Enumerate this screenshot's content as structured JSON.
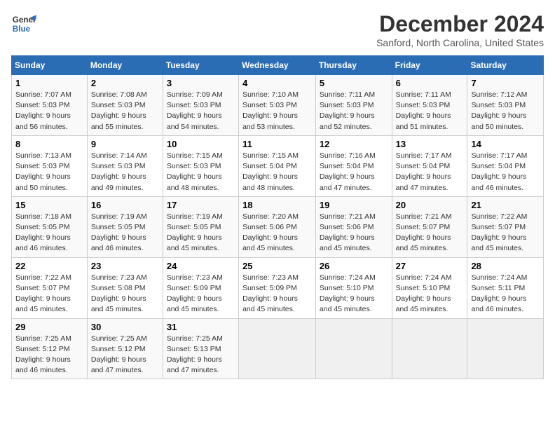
{
  "header": {
    "logo_line1": "General",
    "logo_line2": "Blue",
    "title": "December 2024",
    "subtitle": "Sanford, North Carolina, United States"
  },
  "weekdays": [
    "Sunday",
    "Monday",
    "Tuesday",
    "Wednesday",
    "Thursday",
    "Friday",
    "Saturday"
  ],
  "weeks": [
    [
      {
        "num": "1",
        "rise": "7:07 AM",
        "set": "5:03 PM",
        "hours": "9 hours and 56 minutes."
      },
      {
        "num": "2",
        "rise": "7:08 AM",
        "set": "5:03 PM",
        "hours": "9 hours and 55 minutes."
      },
      {
        "num": "3",
        "rise": "7:09 AM",
        "set": "5:03 PM",
        "hours": "9 hours and 54 minutes."
      },
      {
        "num": "4",
        "rise": "7:10 AM",
        "set": "5:03 PM",
        "hours": "9 hours and 53 minutes."
      },
      {
        "num": "5",
        "rise": "7:11 AM",
        "set": "5:03 PM",
        "hours": "9 hours and 52 minutes."
      },
      {
        "num": "6",
        "rise": "7:11 AM",
        "set": "5:03 PM",
        "hours": "9 hours and 51 minutes."
      },
      {
        "num": "7",
        "rise": "7:12 AM",
        "set": "5:03 PM",
        "hours": "9 hours and 50 minutes."
      }
    ],
    [
      {
        "num": "8",
        "rise": "7:13 AM",
        "set": "5:03 PM",
        "hours": "9 hours and 50 minutes."
      },
      {
        "num": "9",
        "rise": "7:14 AM",
        "set": "5:03 PM",
        "hours": "9 hours and 49 minutes."
      },
      {
        "num": "10",
        "rise": "7:15 AM",
        "set": "5:03 PM",
        "hours": "9 hours and 48 minutes."
      },
      {
        "num": "11",
        "rise": "7:15 AM",
        "set": "5:04 PM",
        "hours": "9 hours and 48 minutes."
      },
      {
        "num": "12",
        "rise": "7:16 AM",
        "set": "5:04 PM",
        "hours": "9 hours and 47 minutes."
      },
      {
        "num": "13",
        "rise": "7:17 AM",
        "set": "5:04 PM",
        "hours": "9 hours and 47 minutes."
      },
      {
        "num": "14",
        "rise": "7:17 AM",
        "set": "5:04 PM",
        "hours": "9 hours and 46 minutes."
      }
    ],
    [
      {
        "num": "15",
        "rise": "7:18 AM",
        "set": "5:05 PM",
        "hours": "9 hours and 46 minutes."
      },
      {
        "num": "16",
        "rise": "7:19 AM",
        "set": "5:05 PM",
        "hours": "9 hours and 46 minutes."
      },
      {
        "num": "17",
        "rise": "7:19 AM",
        "set": "5:05 PM",
        "hours": "9 hours and 45 minutes."
      },
      {
        "num": "18",
        "rise": "7:20 AM",
        "set": "5:06 PM",
        "hours": "9 hours and 45 minutes."
      },
      {
        "num": "19",
        "rise": "7:21 AM",
        "set": "5:06 PM",
        "hours": "9 hours and 45 minutes."
      },
      {
        "num": "20",
        "rise": "7:21 AM",
        "set": "5:07 PM",
        "hours": "9 hours and 45 minutes."
      },
      {
        "num": "21",
        "rise": "7:22 AM",
        "set": "5:07 PM",
        "hours": "9 hours and 45 minutes."
      }
    ],
    [
      {
        "num": "22",
        "rise": "7:22 AM",
        "set": "5:07 PM",
        "hours": "9 hours and 45 minutes."
      },
      {
        "num": "23",
        "rise": "7:23 AM",
        "set": "5:08 PM",
        "hours": "9 hours and 45 minutes."
      },
      {
        "num": "24",
        "rise": "7:23 AM",
        "set": "5:09 PM",
        "hours": "9 hours and 45 minutes."
      },
      {
        "num": "25",
        "rise": "7:23 AM",
        "set": "5:09 PM",
        "hours": "9 hours and 45 minutes."
      },
      {
        "num": "26",
        "rise": "7:24 AM",
        "set": "5:10 PM",
        "hours": "9 hours and 45 minutes."
      },
      {
        "num": "27",
        "rise": "7:24 AM",
        "set": "5:10 PM",
        "hours": "9 hours and 45 minutes."
      },
      {
        "num": "28",
        "rise": "7:24 AM",
        "set": "5:11 PM",
        "hours": "9 hours and 46 minutes."
      }
    ],
    [
      {
        "num": "29",
        "rise": "7:25 AM",
        "set": "5:12 PM",
        "hours": "9 hours and 46 minutes."
      },
      {
        "num": "30",
        "rise": "7:25 AM",
        "set": "5:12 PM",
        "hours": "9 hours and 47 minutes."
      },
      {
        "num": "31",
        "rise": "7:25 AM",
        "set": "5:13 PM",
        "hours": "9 hours and 47 minutes."
      },
      null,
      null,
      null,
      null
    ]
  ],
  "labels": {
    "sunrise": "Sunrise:",
    "sunset": "Sunset:",
    "daylight": "Daylight:"
  }
}
